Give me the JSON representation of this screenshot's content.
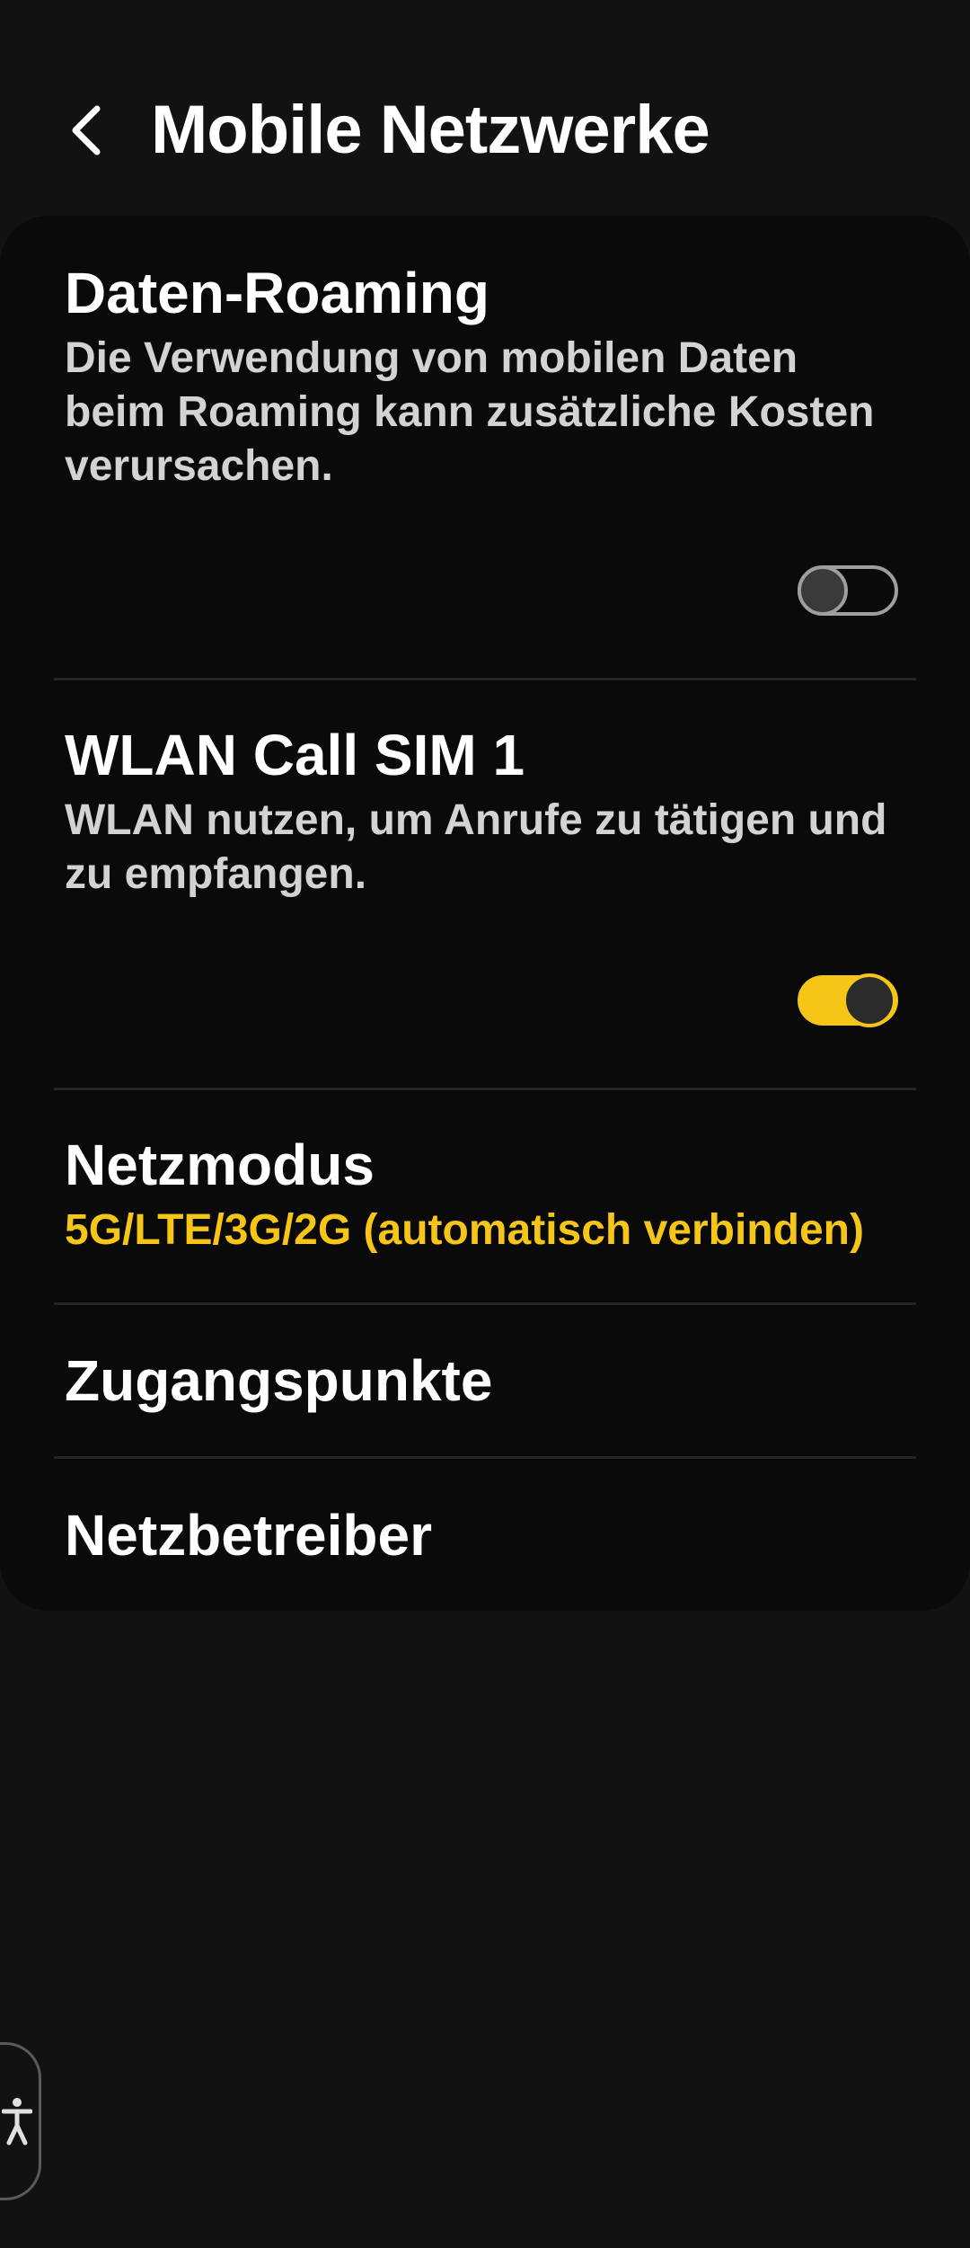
{
  "header": {
    "title": "Mobile Netzwerke",
    "back_icon": "chevron-left-icon"
  },
  "settings": [
    {
      "title": "Daten-Roaming",
      "summary": "Die Verwendung von mobilen Daten beim Roaming kann zusätzliche Kosten verursachen.",
      "toggle": false
    },
    {
      "title": "WLAN Call SIM 1",
      "summary": "WLAN nutzen, um Anrufe zu tätigen und zu empfangen.",
      "toggle": true
    },
    {
      "title": "Netzmodus",
      "summary": "5G/LTE/3G/2G (automatisch verbinden)"
    },
    {
      "title": "Zugangspunkte"
    },
    {
      "title": "Netzbetreiber"
    }
  ],
  "colors": {
    "background": "#121212",
    "card": "#0a0a0a",
    "accent": "#f5c518",
    "summary_text": "#d3d3d3"
  },
  "accessibility": {
    "icon": "accessibility-icon"
  }
}
